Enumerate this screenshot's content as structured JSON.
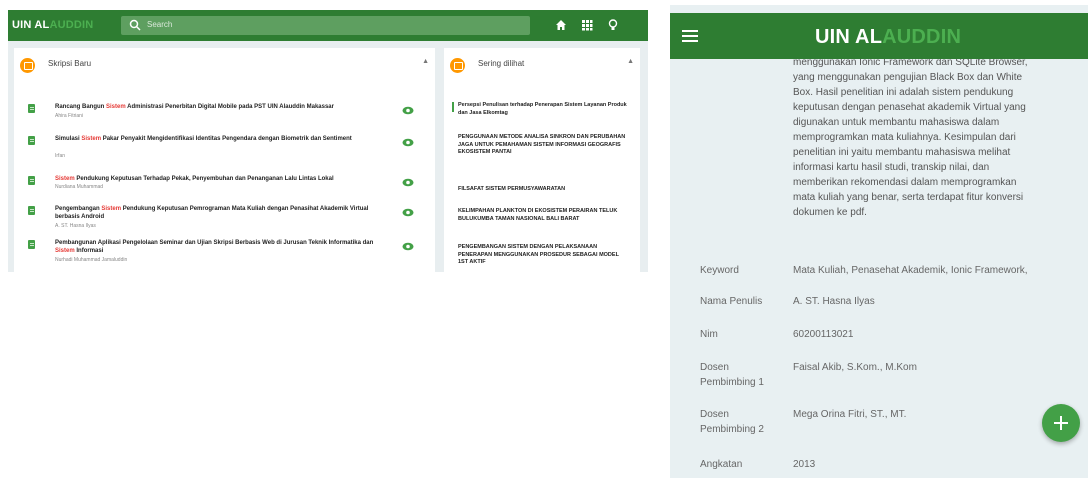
{
  "desktop": {
    "logo_main": "UIN AL",
    "logo_accent": "AUDDIN",
    "search_placeholder": "Search",
    "main_panel_title": "Skripsi Baru",
    "side_panel_title": "Sering dilihat",
    "items": [
      {
        "title": "Rancang Bangun",
        "title_red": "Sistem",
        "title_rest": "Administrasi Penerbitan Digital Mobile pada PST UIN Alauddin Makassar",
        "author": "Ahira Fitriani"
      },
      {
        "title": "Simulasi",
        "title_red": "Sistem",
        "title_rest": "Pakar Penyakit Mengidentifikasi Identitas Pengendara dengan Biometrik dan Sentiment",
        "author": "Irfan"
      },
      {
        "title": "",
        "title_red": "Sistem",
        "title_rest": "Pendukung Keputusan Terhadap Pekak, Penyembuhan dan Penanganan Lalu Lintas Lokal",
        "author": "Nurdiana Muhammad"
      },
      {
        "title": "Pengembangan",
        "title_red": "Sistem",
        "title_rest": "Pendukung Keputusan Pemrograman Mata Kuliah dengan Penasihat Akademik Virtual berbasis Android",
        "author": "A. ST. Hasna Ilyas"
      },
      {
        "title": "Pembangunan Aplikasi Pengelolaan Seminar dan Ujian Skripsi Berbasis Web di Jurusan Teknik Informatika dan",
        "title_red": "Sistem",
        "title_rest": "Informasi",
        "author": "Nurhadi Muhammad Jamaluddin"
      }
    ],
    "side_items": [
      "Persepsi Penulisan terhadap Penerapan Sistem Layanan Produk dan Jasa Elkomtag",
      "Penggunaan Metode Analisa Sinkron dan Perubahan Jaga untuk Pemahaman Sistem Informasi Geografis Ekosistem Pantai",
      "Filsafat Sistem Permusyawaratan",
      "Kelimpahan Plankton di Ekosistem Perairan Teluk Bulukumba Taman Nasional Bali Barat",
      "Pengembangan Sistem Dengan Pelaksanaan Penerapan Menggunakan Prosedur Sebagai Model 1st Aktif"
    ]
  },
  "mobile": {
    "logo_main": "UIN AL",
    "logo_accent": "AUDDIN",
    "abstract_lines": [
      "menggunakan Ionic Framework dan SQLite Browser,",
      "yang menggunakan pengujian Black Box dan White",
      "Box. Hasil penelitian ini adalah sistem pendukung",
      "keputusan dengan penasehat akademik Virtual yang",
      "digunakan untuk membantu mahasiswa dalam",
      "memprogramkan mata kuliahnya. Kesimpulan dari",
      "penelitian ini yaitu membantu mahasiswa melihat",
      "informasi kartu hasil studi, transkip nilai, dan",
      "memberikan rekomendasi dalam memprogramkan",
      "mata kuliah yang benar, serta terdapat fitur konversi",
      "dokumen ke pdf."
    ],
    "keyword_label": "Keyword",
    "keyword_value": "Mata Kuliah, Penasehat Akademik, Ionic Framework,",
    "penulis_label": "Nama Penulis",
    "penulis_value": "A. ST. Hasna Ilyas",
    "nim_label": "Nim",
    "nim_value": "60200113021",
    "dosen1_label_1": "Dosen",
    "dosen1_label_2": "Pembimbing 1",
    "dosen1_value": "Faisal Akib, S.Kom., M.Kom",
    "dosen2_label_1": "Dosen",
    "dosen2_label_2": "Pembimbing 2",
    "dosen2_value": "Mega Orina Fitri, ST., MT.",
    "angkatan_label": "Angkatan",
    "angkatan_value": "2013"
  },
  "colors": {
    "primary": "#2e7d32",
    "accent": "#4caf50",
    "badge": "#ff9800",
    "highlight": "#e53935"
  },
  "icons": [
    "search-icon",
    "home-icon",
    "grid-icon",
    "bulb-icon",
    "menu-icon",
    "eye-icon",
    "document-icon",
    "plus-icon"
  ]
}
